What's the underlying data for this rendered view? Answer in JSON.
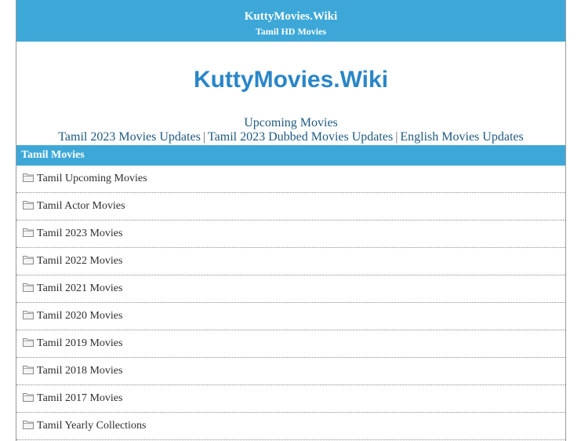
{
  "header": {
    "site_name": "KuttyMovies.Wiki",
    "tagline": "Tamil HD Movies"
  },
  "logo_text": "KuttyMovies.Wiki",
  "nav": {
    "upcoming": "Upcoming Movies",
    "links": [
      "Tamil 2023 Movies Updates",
      "Tamil 2023 Dubbed Movies Updates",
      "English Movies Updates"
    ],
    "separator": "|"
  },
  "section": {
    "title": "Tamil Movies",
    "icon": "folder-icon",
    "items": [
      "Tamil Upcoming Movies",
      "Tamil Actor Movies",
      "Tamil 2023 Movies",
      "Tamil 2022 Movies",
      "Tamil 2021 Movies",
      "Tamil 2020 Movies",
      "Tamil 2019 Movies",
      "Tamil 2018 Movies",
      "Tamil 2017 Movies",
      "Tamil Yearly Collections"
    ]
  },
  "colors": {
    "accent": "#3da8d8",
    "logo": "#2a86c8",
    "link": "#1e5a80"
  }
}
